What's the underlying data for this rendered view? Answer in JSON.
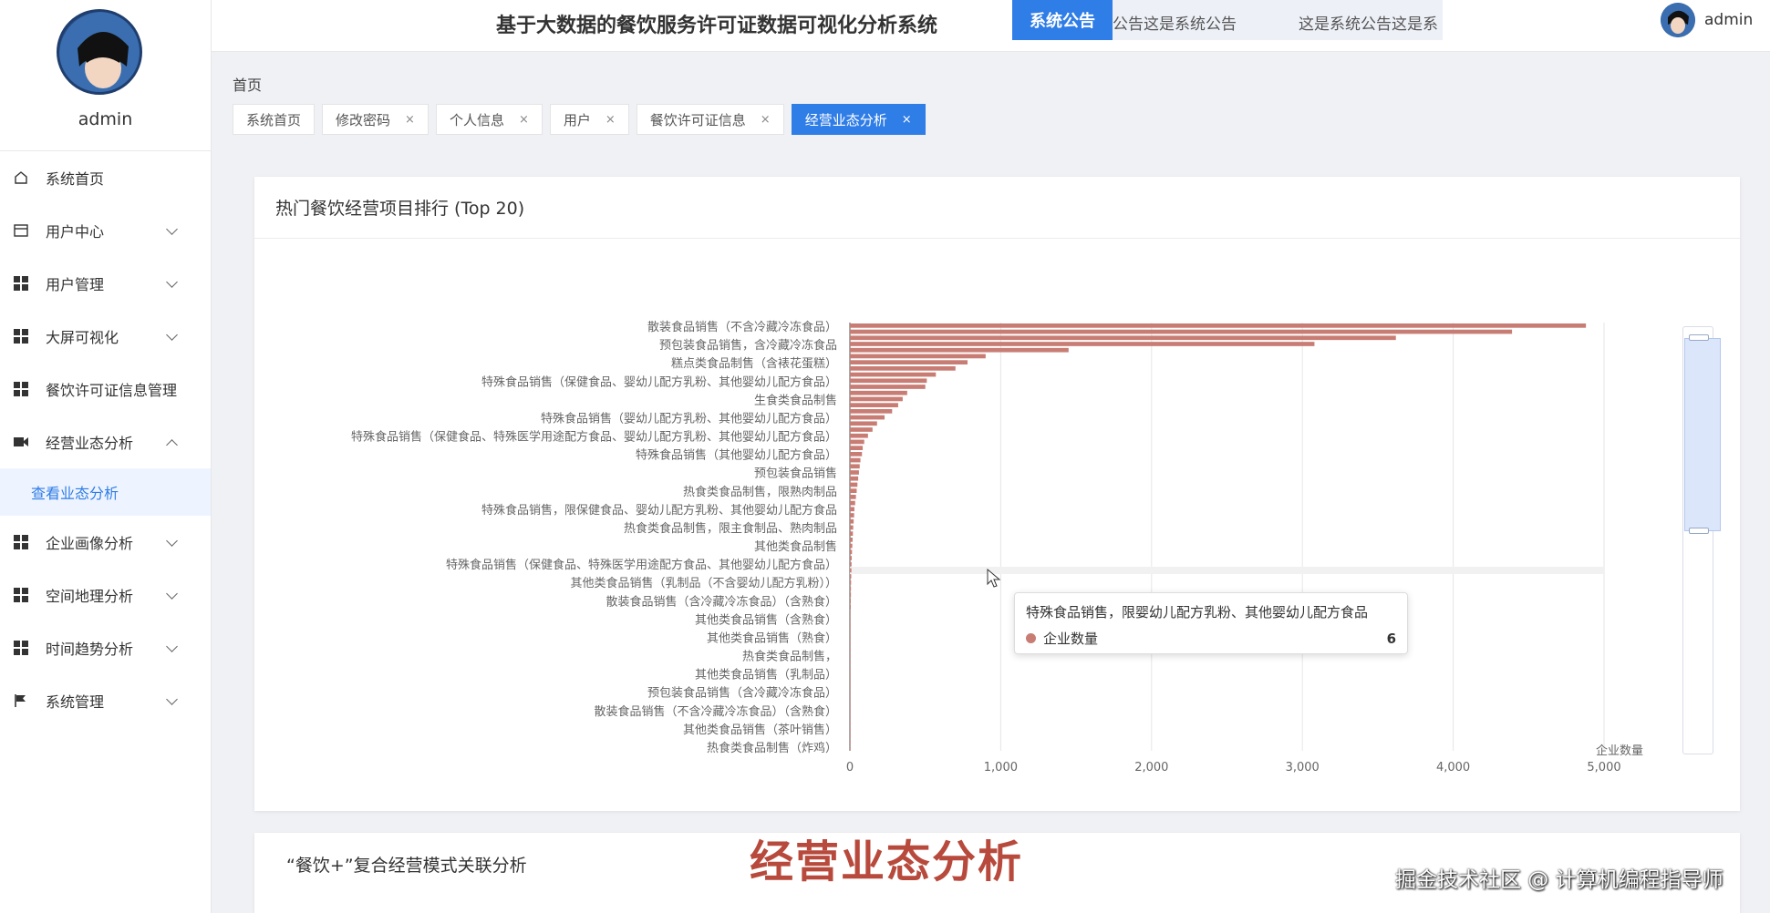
{
  "app": {
    "title": "基于大数据的餐饮服务许可证数据可视化分析系统"
  },
  "notice": {
    "label": "系统公告",
    "text": "公告这是系统公告　　　　这是系统公告这是系"
  },
  "user": {
    "name": "admin"
  },
  "sidebar": {
    "username": "admin",
    "items": [
      {
        "label": "系统首页",
        "icon": "home-icon"
      },
      {
        "label": "用户中心",
        "icon": "card-icon"
      },
      {
        "label": "用户管理",
        "icon": "grid-icon"
      },
      {
        "label": "大屏可视化",
        "icon": "grid-icon"
      },
      {
        "label": "餐饮许可证信息管理",
        "icon": "grid-icon"
      },
      {
        "label": "经营业态分析",
        "icon": "film-icon"
      },
      {
        "label": "企业画像分析",
        "icon": "grid-icon"
      },
      {
        "label": "空间地理分析",
        "icon": "grid-icon"
      },
      {
        "label": "时间趋势分析",
        "icon": "grid-icon"
      },
      {
        "label": "系统管理",
        "icon": "flag-icon"
      }
    ],
    "sub_item": "查看业态分析"
  },
  "breadcrumb": "首页",
  "tabs": [
    {
      "label": "系统首页",
      "closable": false
    },
    {
      "label": "修改密码",
      "closable": true
    },
    {
      "label": "个人信息",
      "closable": true
    },
    {
      "label": "用户",
      "closable": true
    },
    {
      "label": "餐饮许可证信息",
      "closable": true
    },
    {
      "label": "经营业态分析",
      "closable": true
    }
  ],
  "card1": {
    "title": "热门餐饮经营项目排行 (Top 20)"
  },
  "card2": {
    "title": "“餐饮+”复合经营模式关联分析"
  },
  "tooltip": {
    "title": "特殊食品销售，限婴幼儿配方乳粉、其他婴幼儿配方食品",
    "series": "企业数量",
    "value": "6"
  },
  "overlay_title": "经营业态分析",
  "watermark": "掘金技术社区 @ 计算机编程指导师",
  "colors": {
    "accent": "#2f7de6",
    "bar": "#c87d74"
  },
  "chart_data": {
    "type": "bar",
    "orientation": "horizontal",
    "series": [
      {
        "name": "企业数量",
        "values": [
          4880,
          4390,
          3620,
          3080,
          1450,
          900,
          780,
          700,
          570,
          510,
          500,
          380,
          350,
          320,
          280,
          230,
          180,
          150,
          120,
          95,
          85,
          80,
          70,
          65,
          60,
          55,
          50,
          45,
          40,
          35,
          30,
          28,
          25,
          22,
          20,
          18,
          16,
          14,
          12,
          11,
          10,
          9,
          8,
          7,
          7,
          6,
          6,
          5,
          5,
          5,
          4,
          4,
          4,
          3,
          3,
          3,
          3,
          2,
          2,
          2,
          2,
          2,
          2,
          1,
          1,
          1,
          1,
          1,
          1,
          1
        ]
      }
    ],
    "y_labels_visible": [
      "散装食品销售（不含冷藏冷冻食品）",
      "预包装食品销售，含冷藏冷冻食品",
      "糕点类食品制售（含裱花蛋糕）",
      "特殊食品销售（保健食品、婴幼儿配方乳粉、其他婴幼儿配方食品）",
      "生食类食品制售",
      "特殊食品销售（婴幼儿配方乳粉、其他婴幼儿配方食品）",
      "特殊食品销售（保健食品、特殊医学用途配方食品、婴幼儿配方乳粉、其他婴幼儿配方食品）",
      "特殊食品销售（其他婴幼儿配方食品）",
      "预包装食品销售",
      "热食类食品制售，限熟肉制品",
      "特殊食品销售，限保健食品、婴幼儿配方乳粉、其他婴幼儿配方食品",
      "热食类食品制售，限主食制品、熟肉制品",
      "其他类食品制售",
      "特殊食品销售（保健食品、特殊医学用途配方食品、其他婴幼儿配方食品）",
      "其他类食品销售（乳制品（不含婴幼儿配方乳粉））",
      "散装食品销售（含冷藏冷冻食品）（含熟食）",
      "其他类食品销售（含熟食）",
      "其他类食品销售（熟食）",
      "热食类食品制售，",
      "其他类食品销售（乳制品）",
      "预包装食品销售（含冷藏冷冻食品）",
      "散装食品销售（不含冷藏冷冻食品）（含熟食）",
      "其他类食品销售（茶叶销售）",
      "热食类食品制售（炸鸡）"
    ],
    "x_ticks": [
      "0",
      "1,000",
      "2,000",
      "3,000",
      "4,000",
      "5,000"
    ],
    "xlim": [
      0,
      5000
    ],
    "xlabel": "企业数量",
    "grid": true
  }
}
